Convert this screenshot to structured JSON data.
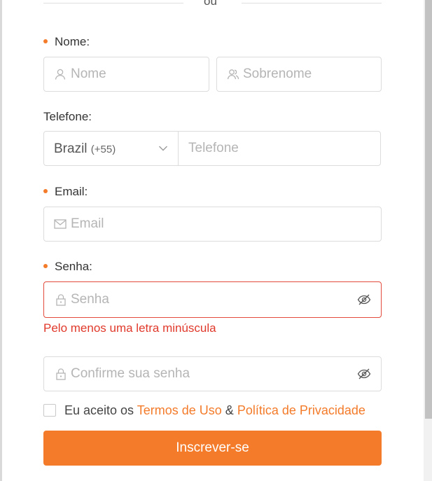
{
  "divider": {
    "text": "ou"
  },
  "form": {
    "name_label": "Nome",
    "first_name_placeholder": "Nome",
    "last_name_placeholder": "Sobrenome",
    "phone_label": "Telefone",
    "country_name": "Brazil",
    "country_code": "(+55)",
    "phone_placeholder": "Telefone",
    "email_label": "Email",
    "email_placeholder": "Email",
    "password_label": "Senha",
    "password_placeholder": "Senha",
    "password_error": "Pelo menos uma letra minúscula",
    "confirm_placeholder": "Confirme sua senha",
    "label_colon": ":",
    "terms": {
      "prefix": "Eu aceito os ",
      "terms_link": "Termos de Uso",
      "separator": " & ",
      "privacy_link": "Política de Privacidade"
    },
    "submit_label": "Inscrever-se"
  },
  "colors": {
    "accent": "#f37b2a",
    "error": "#e0392b",
    "border": "#dcdcdc",
    "placeholder": "#b5b5b5"
  },
  "icons": {
    "first_name": "user-icon",
    "last_name": "users-icon",
    "country_dropdown": "chevron-down-icon",
    "email": "envelope-icon",
    "password": "lock-icon",
    "password_toggle": "eye-off-icon"
  }
}
